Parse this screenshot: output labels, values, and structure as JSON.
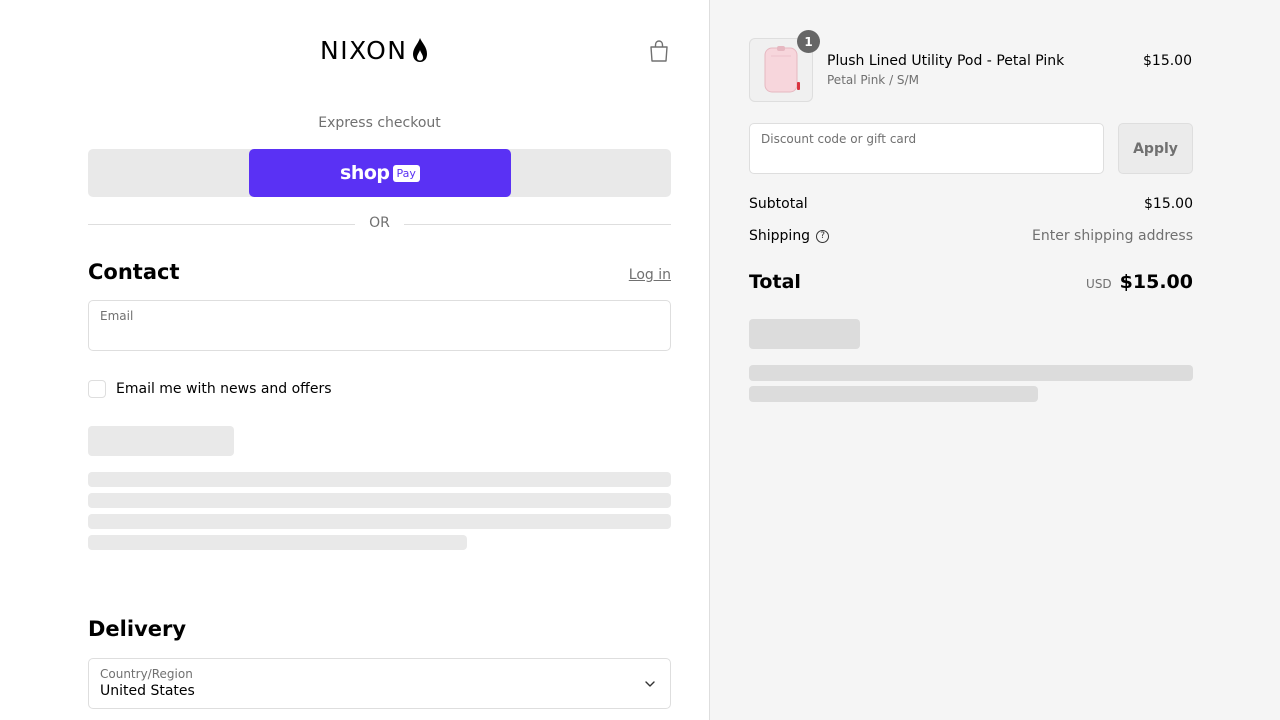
{
  "brand": {
    "logo_text": "NIXON"
  },
  "express": {
    "label": "Express checkout",
    "shop_word": "shop",
    "pay_chip": "Pay"
  },
  "divider": {
    "or_text": "OR"
  },
  "contact": {
    "heading": "Contact",
    "login_link": "Log in",
    "email_label": "Email",
    "email_value": "",
    "newsletter_label": "Email me with news and offers",
    "newsletter_checked": false
  },
  "delivery": {
    "heading": "Delivery",
    "country_label": "Country/Region",
    "country_value": "United States"
  },
  "order": {
    "item": {
      "name": "Plush Lined Utility Pod - Petal Pink",
      "variant": "Petal Pink / S/M",
      "price": "$15.00",
      "quantity": "1"
    },
    "discount": {
      "placeholder": "Discount code or gift card",
      "apply_label": "Apply"
    },
    "subtotal_label": "Subtotal",
    "subtotal_value": "$15.00",
    "shipping_label": "Shipping",
    "shipping_value": "Enter shipping address",
    "total_label": "Total",
    "currency": "USD",
    "total_value": "$15.00"
  },
  "colors": {
    "shop_pay": "#5a31f4",
    "right_panel_bg": "#f5f5f5",
    "skeleton": "#e9e9e9",
    "muted_text": "#707070"
  }
}
